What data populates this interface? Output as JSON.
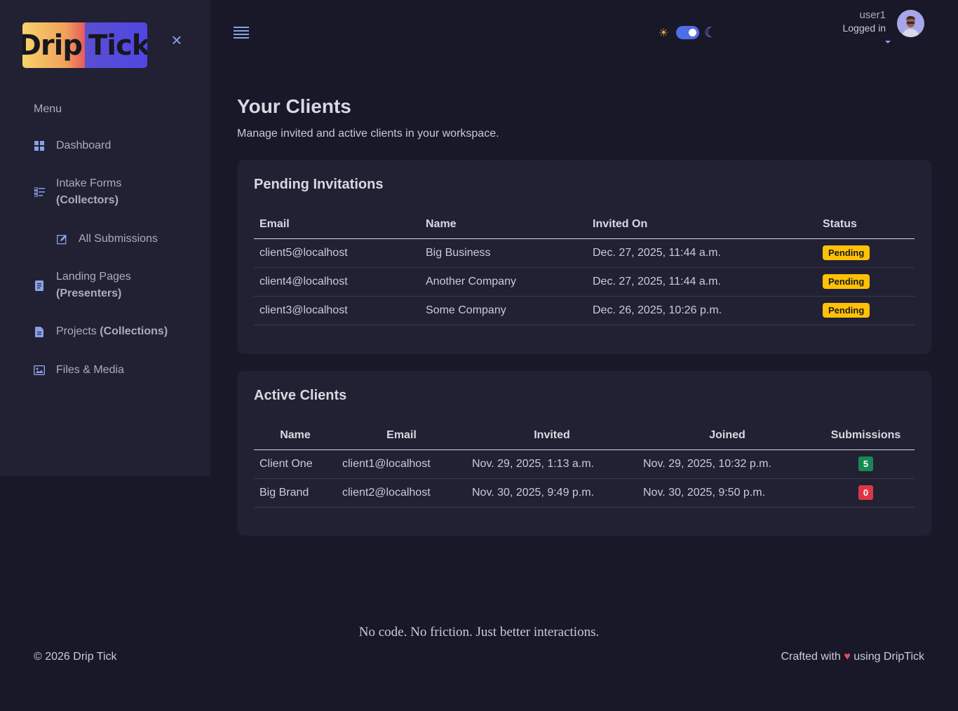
{
  "logo": {
    "part1": "Drip",
    "part2": "Tick"
  },
  "sidebar": {
    "menu_title": "Menu",
    "items": [
      {
        "label": "Dashboard",
        "bold": ""
      },
      {
        "label": "Intake Forms",
        "bold": "(Collectors)"
      },
      {
        "label": "All Submissions",
        "bold": ""
      },
      {
        "label": "Landing Pages",
        "bold": "(Presenters)"
      },
      {
        "label": "Projects",
        "bold": "(Collections)"
      },
      {
        "label": "Files & Media",
        "bold": ""
      }
    ]
  },
  "user": {
    "name": "user1",
    "status": "Logged in"
  },
  "page": {
    "title": "Your Clients",
    "subtitle": "Manage invited and active clients in your workspace."
  },
  "pending": {
    "title": "Pending Invitations",
    "headers": [
      "Email",
      "Name",
      "Invited On",
      "Status"
    ],
    "rows": [
      {
        "email": "client5@localhost",
        "name": "Big Business",
        "invited": "Dec. 27, 2025, 11:44 a.m.",
        "status": "Pending"
      },
      {
        "email": "client4@localhost",
        "name": "Another Company",
        "invited": "Dec. 27, 2025, 11:44 a.m.",
        "status": "Pending"
      },
      {
        "email": "client3@localhost",
        "name": "Some Company",
        "invited": "Dec. 26, 2025, 10:26 p.m.",
        "status": "Pending"
      }
    ]
  },
  "active": {
    "title": "Active Clients",
    "headers": [
      "Name",
      "Email",
      "Invited",
      "Joined",
      "Submissions"
    ],
    "rows": [
      {
        "name": "Client One",
        "email": "client1@localhost",
        "invited": "Nov. 29, 2025, 1:13 a.m.",
        "joined": "Nov. 29, 2025, 10:32 p.m.",
        "submissions": "5",
        "color": "#198754"
      },
      {
        "name": "Big Brand",
        "email": "client2@localhost",
        "invited": "Nov. 30, 2025, 9:49 p.m.",
        "joined": "Nov. 30, 2025, 9:50 p.m.",
        "submissions": "0",
        "color": "#dc3545"
      }
    ]
  },
  "footer": {
    "tagline": "No code. No friction. Just better interactions.",
    "copyright": "© 2026 Drip Tick",
    "crafted_prefix": "Crafted with",
    "crafted_heart": "♥",
    "crafted_suffix": "using DripTick"
  },
  "colors": {
    "background": "#181828",
    "panel": "#212133",
    "accent": "#4e6ee8",
    "pending": "#ffc107"
  }
}
